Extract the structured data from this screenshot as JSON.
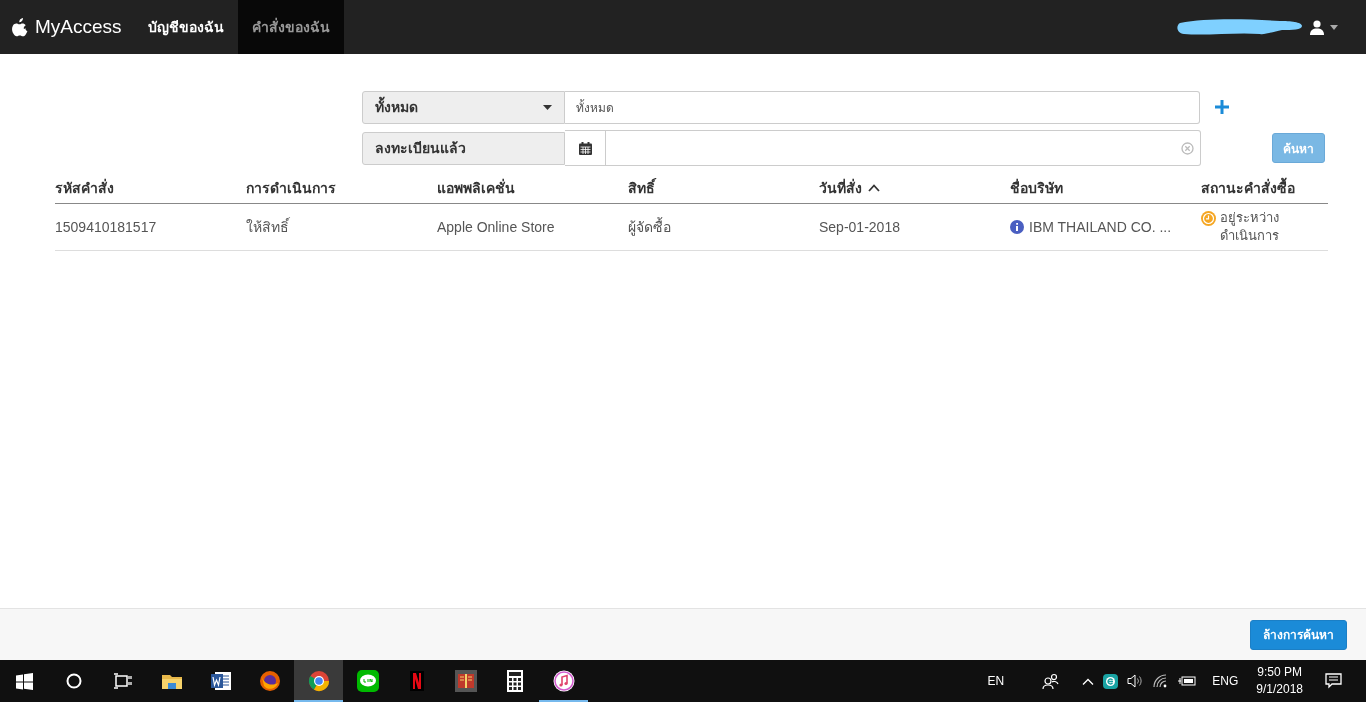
{
  "navbar": {
    "brand": "MyAccess",
    "tabs": [
      {
        "label": "บัญชีของฉัน",
        "selected": false
      },
      {
        "label": "คำสั่งของฉัน",
        "selected": true
      }
    ]
  },
  "filters": {
    "type_select": {
      "value": "ทั้งหมด"
    },
    "type_field": {
      "value": "ทั้งหมด"
    },
    "status_label": "ลงทะเบียนแล้ว",
    "search_button": {
      "label": "ค้นหา",
      "disabled": true
    }
  },
  "table": {
    "columns": [
      {
        "label": "รหัสคำสั่ง",
        "sorted": false
      },
      {
        "label": "การดำเนินการ",
        "sorted": false
      },
      {
        "label": "แอพพลิเคชั่น",
        "sorted": false
      },
      {
        "label": "สิทธิ์",
        "sorted": false
      },
      {
        "label": "วันที่สั่ง",
        "sorted": true
      },
      {
        "label": "ชื่อบริษัท",
        "sorted": false
      },
      {
        "label": "สถานะคำสั่งซื้อ",
        "sorted": false
      }
    ],
    "rows": [
      {
        "cells": [
          "1509410181517",
          "ให้สิทธิ์",
          "Apple Online Store",
          "ผู้จัดซื้อ",
          "Sep-01-2018",
          "IBM THAILAND CO. ...",
          "อยู่ระหว่างดำเนินการ"
        ]
      }
    ]
  },
  "footer": {
    "clear_button": "ล้างการค้นหา"
  },
  "taskbar": {
    "apps": [
      {
        "kind": "explorer",
        "running": false,
        "active": false
      },
      {
        "kind": "word",
        "running": false,
        "active": false
      },
      {
        "kind": "firefox",
        "running": false,
        "active": false
      },
      {
        "kind": "chrome",
        "running": true,
        "active": true
      },
      {
        "kind": "line",
        "running": false,
        "active": false
      },
      {
        "kind": "netflix",
        "running": false,
        "active": false
      },
      {
        "kind": "reader",
        "running": false,
        "active": false
      },
      {
        "kind": "calculator",
        "running": false,
        "active": false
      },
      {
        "kind": "itunes",
        "running": true,
        "active": false
      }
    ],
    "language": "EN",
    "input_language": "ENG",
    "time": "9:50 PM",
    "date": "9/1/2018"
  }
}
